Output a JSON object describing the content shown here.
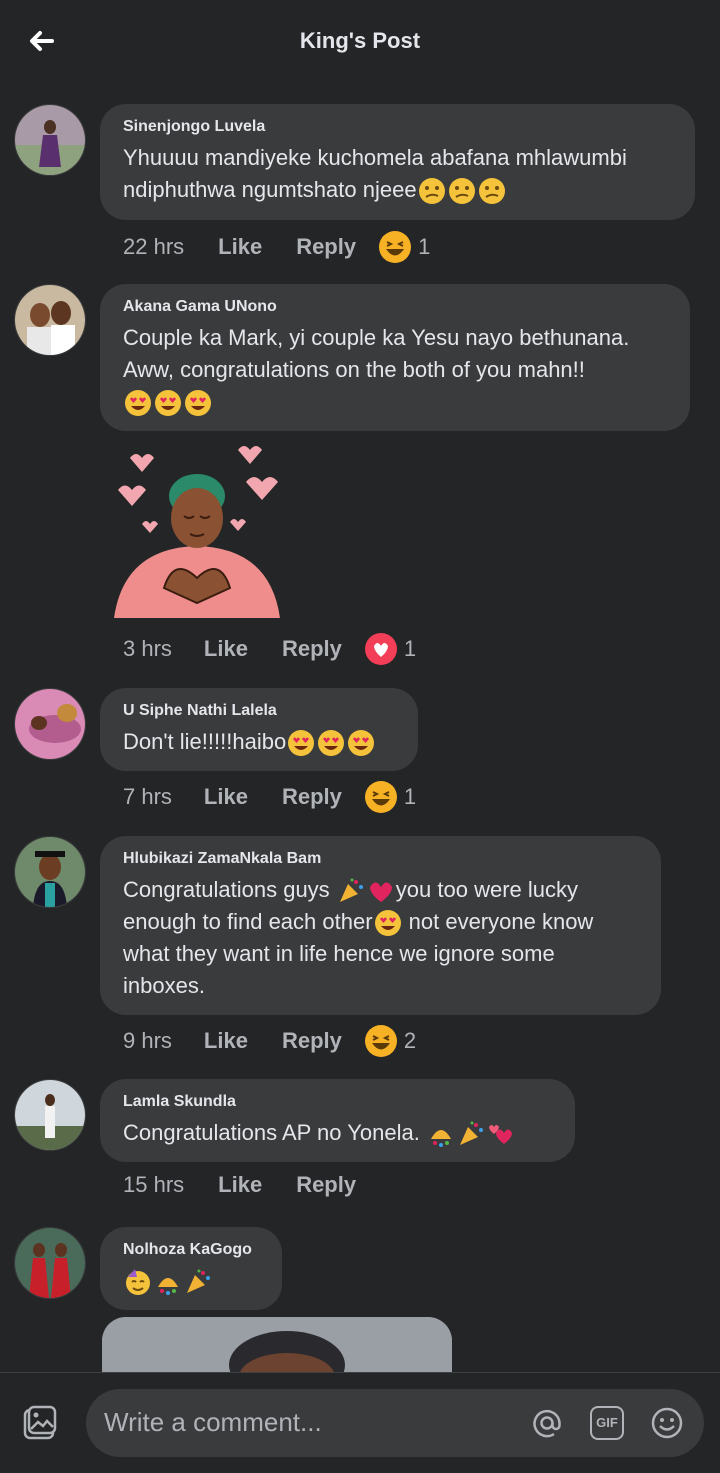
{
  "header": {
    "title": "King's Post"
  },
  "comments": [
    {
      "name": "Sinenjongo Luvela",
      "text": "Yhuuuu mandiyeke kuchomela abafana mhlawumbi ndiphuthwa ngumtshato njeee",
      "time": "22 hrs",
      "like": "Like",
      "reply": "Reply",
      "reaction": "laugh",
      "count": "1"
    },
    {
      "name": "Akana Gama UNono",
      "text": "Couple ka Mark, yi couple ka Yesu nayo bethunana. Aww, congratulations on the both of you mahn!!",
      "time": "3 hrs",
      "like": "Like",
      "reply": "Reply",
      "reaction": "love",
      "count": "1"
    },
    {
      "name": "U Siphe Nathi Lalela",
      "text": "Don't lie!!!!!haibo",
      "time": "7 hrs",
      "like": "Like",
      "reply": "Reply",
      "reaction": "laugh",
      "count": "1"
    },
    {
      "name": "Hlubikazi ZamaNkala Bam",
      "text_a": "Congratulations guys ",
      "text_b": "you too were lucky",
      "text_c": "enough to find each other",
      "text_d": " not everyone know",
      "text_e": "what they want in life hence we ignore some",
      "text_f": "inboxes.",
      "time": "9 hrs",
      "like": "Like",
      "reply": "Reply",
      "reaction": "laugh",
      "count": "2"
    },
    {
      "name": "Lamla Skundla",
      "text": "Congratulations AP no Yonela. ",
      "time": "15 hrs",
      "like": "Like",
      "reply": "Reply"
    },
    {
      "name": "Nolhoza KaGogo"
    }
  ],
  "composer": {
    "placeholder": "Write a comment...",
    "gif_label": "GIF"
  },
  "colors": {
    "background": "#242526",
    "bubble": "#3a3b3c",
    "muted": "#b0b3b8",
    "text": "#e4e6eb",
    "love": "#f33e58",
    "haha": "#f7b125"
  }
}
